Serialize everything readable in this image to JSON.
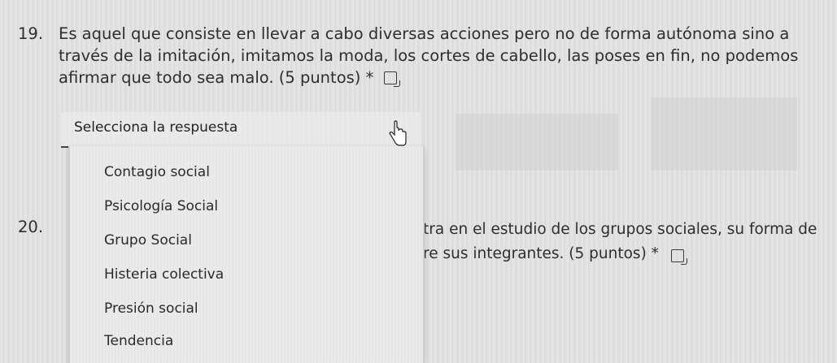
{
  "question19": {
    "number": "19.",
    "text": "Es aquel que consiste en llevar a cabo diversas acciones pero no de forma autónoma sino a través de la imitación, imitamos la moda, los cortes de cabello, las poses en fin, no podemos afirmar que todo sea malo. (5 puntos) *"
  },
  "select": {
    "placeholder": "Selecciona la respuesta",
    "options": [
      "Contagio social",
      "Psicología Social",
      "Grupo Social",
      "Histeria colectiva",
      "Presión social",
      "Tendencia"
    ]
  },
  "question20": {
    "number": "20.",
    "line1_visible": "tra en el estudio de los grupos sociales, su forma de",
    "line2_visible": "re sus integrantes. (5 puntos) *"
  },
  "icons": {
    "immersive_reader": "immersive-reader-icon",
    "cursor": "hand-cursor-icon"
  }
}
